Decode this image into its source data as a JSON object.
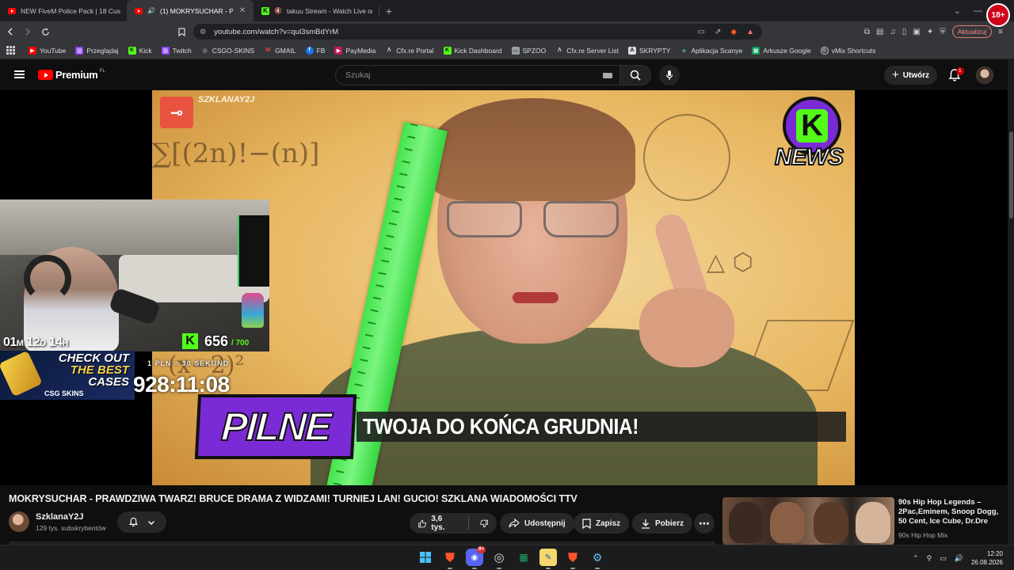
{
  "browser": {
    "tabs": [
      {
        "title": "NEW FiveM Police Pack | 18 Custom",
        "icon": "youtube-icon",
        "active": false
      },
      {
        "title": "(1) MOKRYSUCHAR - PRAWDZ",
        "icon": "youtube-icon",
        "active": true
      },
      {
        "title": "takuu Stream - Watch Live on Kic",
        "icon": "kick-icon",
        "active": false
      }
    ],
    "url": "youtube.com/watch?v=qul3smBdYrM",
    "update_button": "Aktualizuj",
    "age_badge": "18+",
    "bookmarks": [
      {
        "label": "YouTube",
        "icon": "youtube-icon",
        "color": "#ff0000"
      },
      {
        "label": "Przeglądaj",
        "icon": "twitch-icon",
        "color": "#9146ff"
      },
      {
        "label": "Kick",
        "icon": "kick-icon",
        "color": "#53fc18"
      },
      {
        "label": "Twitch",
        "icon": "twitch-icon",
        "color": "#9146ff"
      },
      {
        "label": "CSGO-SKINS",
        "icon": "csgo-skins-icon",
        "color": "#9aa0a6"
      },
      {
        "label": "GMAIL",
        "icon": "gmail-icon",
        "color": "#ea4335"
      },
      {
        "label": "FB",
        "icon": "facebook-icon",
        "color": "#1877f2"
      },
      {
        "label": "PayMedia",
        "icon": "paymedia-icon",
        "color": "#c2185b"
      },
      {
        "label": "Cfx.re Portal",
        "icon": "cfx-icon",
        "color": "#cfcfcf"
      },
      {
        "label": "Kick Dashboard",
        "icon": "kick-icon",
        "color": "#53fc18"
      },
      {
        "label": "SPZOO",
        "icon": "folder-icon",
        "color": "#9aa0a6"
      },
      {
        "label": "Cfx.re Server List",
        "icon": "cfx-icon",
        "color": "#cfcfcf"
      },
      {
        "label": "SKRYPTY",
        "icon": "skrypty-icon",
        "color": "#cfcfcf"
      },
      {
        "label": "Aplikacja Scanye",
        "icon": "scanye-icon",
        "color": "#4db6ac"
      },
      {
        "label": "Arkusze Google",
        "icon": "sheets-icon",
        "color": "#0f9d58"
      },
      {
        "label": "vMix Shortcuts",
        "icon": "vmix-icon",
        "color": "#cfcfcf"
      }
    ]
  },
  "youtube": {
    "logo_text": "Premium",
    "logo_region": "PL",
    "search_placeholder": "Szukaj",
    "create_label": "Utwórz",
    "notifications": "1"
  },
  "thumbnail": {
    "watermark": "SZKLANAY2J",
    "news_label": "NEWS",
    "pilne": "PILNE",
    "banner": "TWOJA DO KOŃCA GRUDNIA!"
  },
  "overlay": {
    "kick_count": "656",
    "kick_max": "/ 700",
    "timer_small": {
      "m": "01",
      "d": "12",
      "h": "14",
      "mu": "M",
      "du": "D",
      "hu": "H"
    },
    "ad_line1": "CHECK OUT",
    "ad_line2": "THE BEST",
    "ad_line3": "CASES",
    "ad_brand": "CSG SKINS",
    "pln_rate": "1 PLN = 30 SEKUND",
    "big_timer": "928:11:08"
  },
  "video": {
    "title": "MOKRYSUCHAR - PRAWDZIWA TWARZ! BRUCE DRAMA Z WIDZAMI! TURNIEJ LAN! GUCIO! SZKLANA WIADOMOŚCI TTV",
    "channel": "SzklanaY2J",
    "subscribers": "129 tys. subskrybentów",
    "likes": "3,6 tys.",
    "share": "Udostępnij",
    "save": "Zapisz",
    "download": "Pobierz"
  },
  "recommendation": {
    "title": "90s Hip Hop Legends – 2Pac,Eminem, Snoop Dogg, 50 Cent, Ice Cube, Dr.Dre",
    "channel": "90s Hip Hop Mix"
  },
  "taskbar": {
    "time": "12:20",
    "date": "26.08.2026",
    "discord_badge": "9+"
  }
}
